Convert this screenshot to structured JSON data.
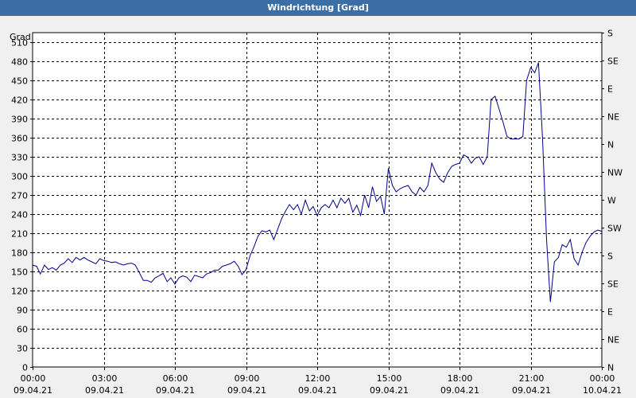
{
  "window": {
    "title": "Windrichtung [Grad]"
  },
  "chart_data": {
    "type": "line",
    "ylabel": "Grad",
    "ylim": [
      0,
      525
    ],
    "y_ticks": [
      0,
      30,
      60,
      90,
      120,
      150,
      180,
      210,
      240,
      270,
      300,
      330,
      360,
      390,
      420,
      450,
      480,
      510
    ],
    "x_range_hours": [
      0,
      24
    ],
    "x_ticks": [
      {
        "h": 0,
        "time": "00:00",
        "date": "09.04.21"
      },
      {
        "h": 3,
        "time": "03:00",
        "date": "09.04.21"
      },
      {
        "h": 6,
        "time": "06:00",
        "date": "09.04.21"
      },
      {
        "h": 9,
        "time": "09:00",
        "date": "09.04.21"
      },
      {
        "h": 12,
        "time": "12:00",
        "date": "09.04.21"
      },
      {
        "h": 15,
        "time": "15:00",
        "date": "09.04.21"
      },
      {
        "h": 18,
        "time": "18:00",
        "date": "09.04.21"
      },
      {
        "h": 21,
        "time": "21:00",
        "date": "09.04.21"
      },
      {
        "h": 24,
        "time": "00:00",
        "date": "10.04.21"
      }
    ],
    "right_axis_ticks": [
      {
        "v": 0,
        "label": "N"
      },
      {
        "v": 45,
        "label": "NE"
      },
      {
        "v": 90,
        "label": "E"
      },
      {
        "v": 135,
        "label": "SE"
      },
      {
        "v": 180,
        "label": "S"
      },
      {
        "v": 225,
        "label": "SW"
      },
      {
        "v": 270,
        "label": "W"
      },
      {
        "v": 315,
        "label": "NW"
      },
      {
        "v": 360,
        "label": "N"
      },
      {
        "v": 405,
        "label": "NE"
      },
      {
        "v": 450,
        "label": "E"
      },
      {
        "v": 495,
        "label": "SE"
      },
      {
        "v": 540,
        "label": "S"
      }
    ],
    "grid": true,
    "series": [
      {
        "color": "#00008b",
        "points": [
          [
            0.0,
            160
          ],
          [
            0.17,
            158
          ],
          [
            0.33,
            146
          ],
          [
            0.5,
            160
          ],
          [
            0.67,
            153
          ],
          [
            0.83,
            156
          ],
          [
            1.0,
            152
          ],
          [
            1.17,
            160
          ],
          [
            1.33,
            163
          ],
          [
            1.5,
            170
          ],
          [
            1.67,
            164
          ],
          [
            1.83,
            172
          ],
          [
            2.0,
            168
          ],
          [
            2.17,
            172
          ],
          [
            2.33,
            168
          ],
          [
            2.5,
            165
          ],
          [
            2.67,
            162
          ],
          [
            2.83,
            170
          ],
          [
            3.0,
            167
          ],
          [
            3.17,
            166
          ],
          [
            3.33,
            164
          ],
          [
            3.5,
            165
          ],
          [
            3.67,
            162
          ],
          [
            3.83,
            160
          ],
          [
            4.0,
            162
          ],
          [
            4.17,
            163
          ],
          [
            4.33,
            160
          ],
          [
            4.5,
            148
          ],
          [
            4.67,
            136
          ],
          [
            4.83,
            136
          ],
          [
            5.0,
            133
          ],
          [
            5.17,
            140
          ],
          [
            5.33,
            143
          ],
          [
            5.5,
            147
          ],
          [
            5.67,
            134
          ],
          [
            5.83,
            140
          ],
          [
            6.0,
            130
          ],
          [
            6.17,
            140
          ],
          [
            6.33,
            143
          ],
          [
            6.5,
            141
          ],
          [
            6.67,
            134
          ],
          [
            6.83,
            144
          ],
          [
            7.0,
            142
          ],
          [
            7.17,
            140
          ],
          [
            7.33,
            146
          ],
          [
            7.5,
            148
          ],
          [
            7.67,
            152
          ],
          [
            7.83,
            152
          ],
          [
            8.0,
            158
          ],
          [
            8.17,
            160
          ],
          [
            8.33,
            162
          ],
          [
            8.5,
            166
          ],
          [
            8.67,
            158
          ],
          [
            8.83,
            145
          ],
          [
            9.0,
            153
          ],
          [
            9.17,
            175
          ],
          [
            9.33,
            188
          ],
          [
            9.5,
            205
          ],
          [
            9.67,
            214
          ],
          [
            9.83,
            212
          ],
          [
            10.0,
            215
          ],
          [
            10.17,
            200
          ],
          [
            10.33,
            216
          ],
          [
            10.5,
            233
          ],
          [
            10.67,
            245
          ],
          [
            10.83,
            255
          ],
          [
            11.0,
            247
          ],
          [
            11.17,
            255
          ],
          [
            11.33,
            240
          ],
          [
            11.5,
            262
          ],
          [
            11.67,
            245
          ],
          [
            11.83,
            252
          ],
          [
            12.0,
            238
          ],
          [
            12.17,
            250
          ],
          [
            12.33,
            255
          ],
          [
            12.5,
            250
          ],
          [
            12.67,
            262
          ],
          [
            12.83,
            250
          ],
          [
            13.0,
            265
          ],
          [
            13.17,
            257
          ],
          [
            13.33,
            265
          ],
          [
            13.5,
            243
          ],
          [
            13.67,
            254
          ],
          [
            13.83,
            238
          ],
          [
            14.0,
            270
          ],
          [
            14.17,
            250
          ],
          [
            14.33,
            283
          ],
          [
            14.5,
            260
          ],
          [
            14.67,
            268
          ],
          [
            14.83,
            240
          ],
          [
            15.0,
            312
          ],
          [
            15.17,
            285
          ],
          [
            15.33,
            275
          ],
          [
            15.5,
            280
          ],
          [
            15.67,
            283
          ],
          [
            15.83,
            285
          ],
          [
            16.0,
            275
          ],
          [
            16.17,
            270
          ],
          [
            16.33,
            282
          ],
          [
            16.5,
            275
          ],
          [
            16.67,
            285
          ],
          [
            16.83,
            320
          ],
          [
            17.0,
            305
          ],
          [
            17.17,
            295
          ],
          [
            17.33,
            290
          ],
          [
            17.5,
            305
          ],
          [
            17.67,
            315
          ],
          [
            17.83,
            318
          ],
          [
            18.0,
            320
          ],
          [
            18.17,
            333
          ],
          [
            18.33,
            330
          ],
          [
            18.5,
            320
          ],
          [
            18.67,
            328
          ],
          [
            18.83,
            330
          ],
          [
            19.0,
            318
          ],
          [
            19.17,
            330
          ],
          [
            19.33,
            420
          ],
          [
            19.5,
            425
          ],
          [
            19.67,
            405
          ],
          [
            19.83,
            385
          ],
          [
            20.0,
            362
          ],
          [
            20.17,
            358
          ],
          [
            20.33,
            358
          ],
          [
            20.5,
            358
          ],
          [
            20.67,
            362
          ],
          [
            20.83,
            450
          ],
          [
            21.0,
            470
          ],
          [
            21.17,
            462
          ],
          [
            21.33,
            478
          ],
          [
            21.5,
            360
          ],
          [
            21.67,
            200
          ],
          [
            21.83,
            102
          ],
          [
            22.0,
            165
          ],
          [
            22.17,
            172
          ],
          [
            22.33,
            192
          ],
          [
            22.5,
            188
          ],
          [
            22.67,
            200
          ],
          [
            22.83,
            170
          ],
          [
            23.0,
            160
          ],
          [
            23.17,
            180
          ],
          [
            23.33,
            195
          ],
          [
            23.5,
            205
          ],
          [
            23.67,
            212
          ],
          [
            23.83,
            215
          ],
          [
            24.0,
            213
          ]
        ]
      }
    ]
  }
}
